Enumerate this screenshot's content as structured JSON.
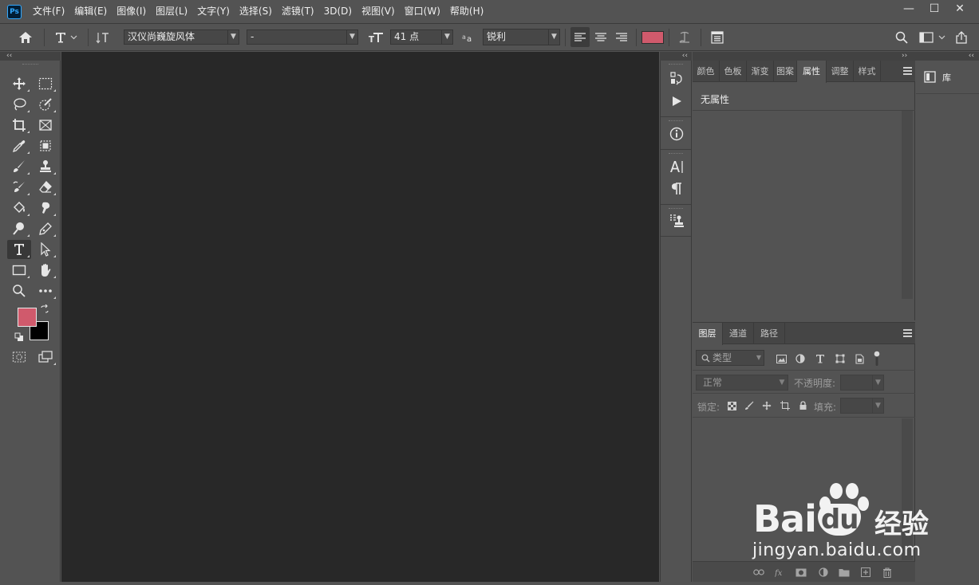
{
  "app": {
    "logo_text": "Ps"
  },
  "menu": [
    "文件(F)",
    "编辑(E)",
    "图像(I)",
    "图层(L)",
    "文字(Y)",
    "选择(S)",
    "滤镜(T)",
    "3D(D)",
    "视图(V)",
    "窗口(W)",
    "帮助(H)"
  ],
  "window_controls": {
    "minimize": "—",
    "maximize": "☐",
    "close": "✕"
  },
  "options_bar": {
    "font_family": "汉仪尚巍旋风体",
    "font_style": "-",
    "font_size": "41 点",
    "anti_alias": "锐利",
    "text_color": "#d05a6c"
  },
  "collapse": {
    "left": "‹‹",
    "middle": "‹‹",
    "right_left": "‹‹",
    "right_right": "››"
  },
  "colors": {
    "foreground": "#d05a6c",
    "background": "#000000",
    "canvas": "#282828",
    "ui": "#535353"
  },
  "properties_panel": {
    "tabs": [
      "颜色",
      "色板",
      "渐变",
      "图案",
      "属性",
      "调整",
      "样式"
    ],
    "active_tab": "属性",
    "empty_text": "无属性"
  },
  "layers_panel": {
    "tabs": [
      "图层",
      "通道",
      "路径"
    ],
    "active_tab": "图层",
    "filter_placeholder": "类型",
    "blend_mode": "正常",
    "opacity_label": "不透明度:",
    "lock_label": "锁定:",
    "fill_label": "填充:"
  },
  "library_panel": {
    "label": "库"
  },
  "watermark": {
    "brand": "Bai",
    "brand2": "du",
    "jingyan": "经验",
    "url": "jingyan.baidu.com"
  }
}
